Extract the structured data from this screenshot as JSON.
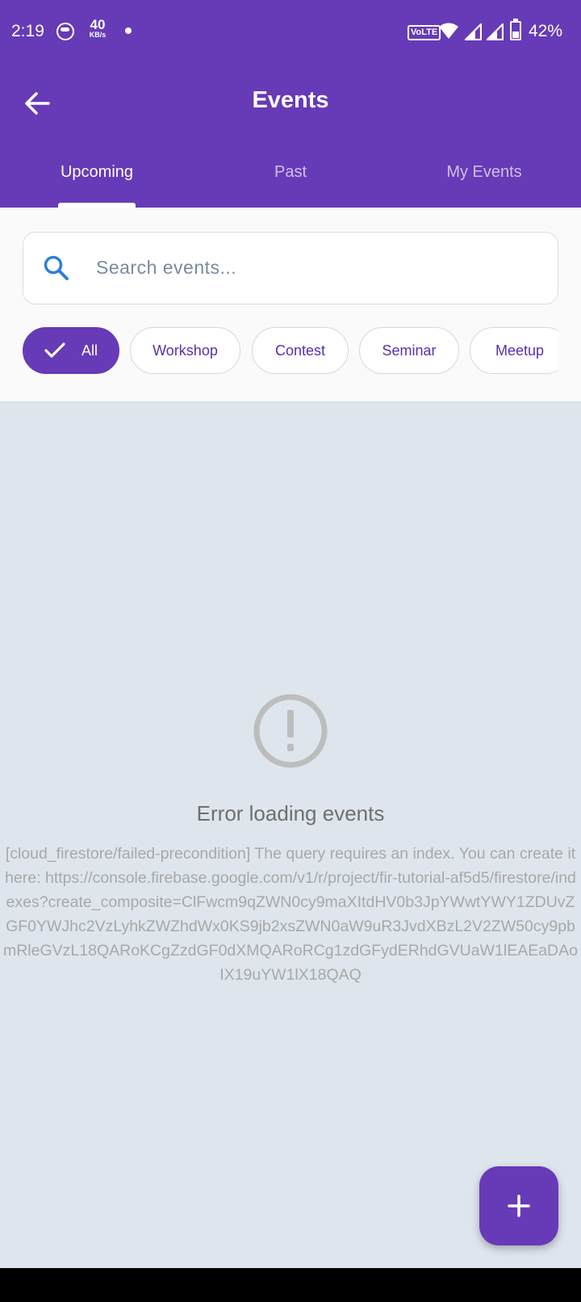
{
  "status_bar": {
    "time": "2:19",
    "speed_value": "40",
    "speed_unit": "KB/s",
    "volte": "VoLTE",
    "battery_pct": "42%",
    "battery_level": 0.42
  },
  "app_bar": {
    "title": "Events",
    "color": "#673ab7"
  },
  "tabs": [
    {
      "label": "Upcoming",
      "active": true
    },
    {
      "label": "Past",
      "active": false
    },
    {
      "label": "My Events",
      "active": false
    }
  ],
  "search": {
    "placeholder": "Search events...",
    "value": ""
  },
  "filters": [
    {
      "label": "All",
      "selected": true
    },
    {
      "label": "Workshop",
      "selected": false
    },
    {
      "label": "Contest",
      "selected": false
    },
    {
      "label": "Seminar",
      "selected": false
    },
    {
      "label": "Meetup",
      "selected": false
    }
  ],
  "error": {
    "icon": "error-outline-icon",
    "title": "Error loading events",
    "message": "[cloud_firestore/failed-precondition] The query requires an index. You can create it here: https://console.firebase.google.com/v1/r/project/fir-tutorial-af5d5/firestore/indexes?create_composite=ClFwcm9qZWN0cy9maXItdHV0b3JpYWwtYWY1ZDUvZGF0YWJhc2VzLyhkZWZhdWx0KS9jb2xsZWN0aW9uR3JvdXBzL2V2ZW50cy9pbmRleGVzL18QARoKCgZzdGF0dXMQARoRCg1zdGFydERhdGVUaW1lEAEaDAoIX19uYW1lX18QAQ"
  },
  "fab": {
    "icon": "plus-icon"
  }
}
